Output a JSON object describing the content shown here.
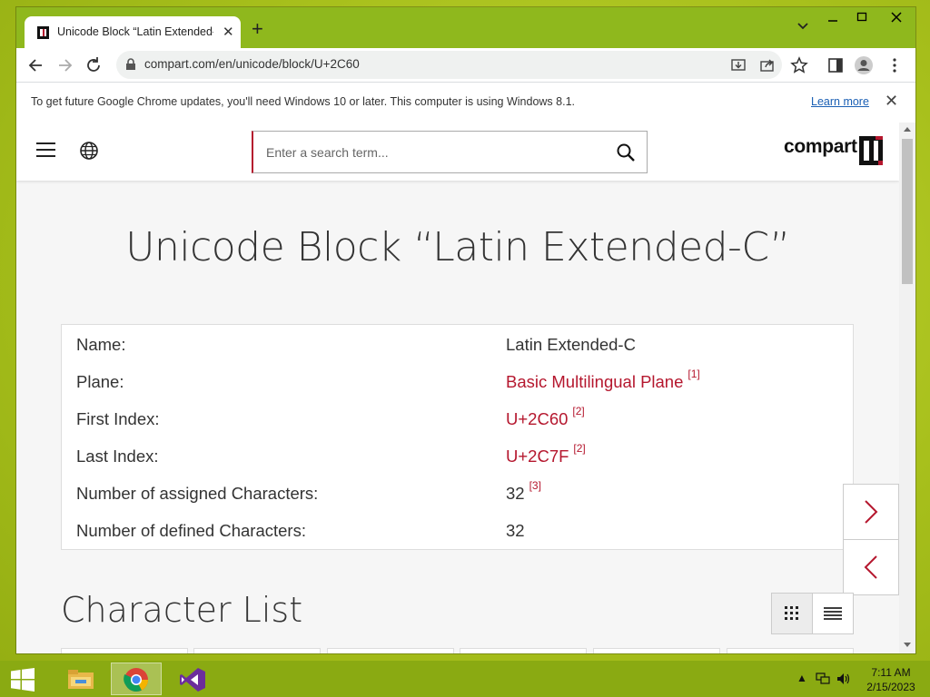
{
  "browser": {
    "tab_title": "Unicode Block “Latin Extended-C",
    "url": "compart.com/en/unicode/block/U+2C60",
    "infobar_text": "To get future Google Chrome updates, you'll need Windows 10 or later. This computer is using Windows 8.1.",
    "infobar_link": "Learn more"
  },
  "site": {
    "search_placeholder": "Enter a search term...",
    "logo_text": "compart"
  },
  "page": {
    "title": "Unicode Block “Latin Extended-C”",
    "rows": [
      {
        "label": "Name:",
        "value": "Latin Extended-C",
        "sup": ""
      },
      {
        "label": "Plane:",
        "value": "Basic Multilingual Plane",
        "sup": "[1]"
      },
      {
        "label": "First Index:",
        "value": "U+2C60",
        "sup": "[2]"
      },
      {
        "label": "Last Index:",
        "value": "U+2C7F",
        "sup": "[2]"
      },
      {
        "label": "Number of assigned Characters:",
        "value": "32",
        "sup": "[3]"
      },
      {
        "label": "Number of defined Characters:",
        "value": "32",
        "sup": ""
      }
    ],
    "section_title": "Character List"
  },
  "taskbar": {
    "time": "7:11 AM",
    "date": "2/15/2023"
  },
  "colors": {
    "accent": "#b5172e",
    "desktop": "#a9c41b",
    "tabbar": "#8fb81d"
  }
}
